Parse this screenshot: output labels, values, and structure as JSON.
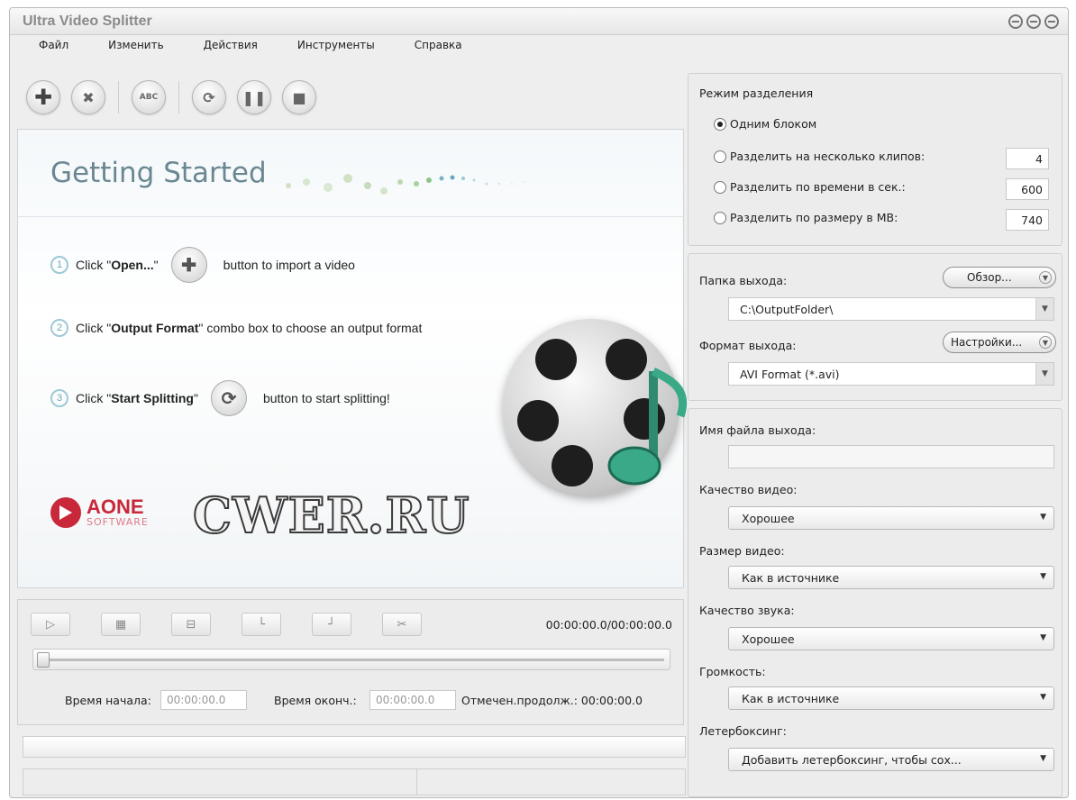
{
  "window": {
    "title": "Ultra Video Splitter"
  },
  "menu": [
    "Файл",
    "Изменить",
    "Действия",
    "Инструменты",
    "Справка"
  ],
  "toolbar": {
    "abc_label": "ABC"
  },
  "getting_started": {
    "title": "Getting Started",
    "steps": [
      {
        "num": "1",
        "prefix": "Click \"",
        "bold": "Open...",
        "suffix_q": "\"",
        "after": "button to import a video"
      },
      {
        "num": "2",
        "prefix": "Click \"",
        "bold": "Output Format",
        "suffix_q": "\"",
        "after": "combo box to choose an output format"
      },
      {
        "num": "3",
        "prefix": "Click \"",
        "bold": "Start Splitting",
        "suffix_q": "\"",
        "after": "button to start splitting!"
      }
    ]
  },
  "logos": {
    "aone_name": "AONE",
    "aone_sub": "SOFTWARE",
    "watermark": "CWER.RU"
  },
  "player": {
    "time_display": "00:00:00.0/00:00:00.0",
    "position": 0,
    "start_label": "Время начала:",
    "start_value": "00:00:00.0",
    "end_label": "Время оконч.:",
    "end_value": "00:00:00.0",
    "duration_label": "Отмечен.продолж.: 00:00:00.0"
  },
  "split_mode": {
    "title": "Режим разделения",
    "options": [
      {
        "label": "Одним блоком",
        "selected": true,
        "value": ""
      },
      {
        "label": "Разделить на несколько клипов:",
        "selected": false,
        "value": "4"
      },
      {
        "label": "Разделить по времени в сек.:",
        "selected": false,
        "value": "600"
      },
      {
        "label": "Разделить по размеру в МВ:",
        "selected": false,
        "value": "740"
      }
    ]
  },
  "output": {
    "folder_label": "Папка выхода:",
    "browse_label": "Обзор...",
    "folder_value": "C:\\OutputFolder\\",
    "format_label": "Формат выхода:",
    "settings_label": "Настройки...",
    "format_value": "AVI Format (*.avi)"
  },
  "options": {
    "filename_label": "Имя файла выхода:",
    "filename_value": "",
    "video_quality_label": "Качество видео:",
    "video_quality_value": "Хорошее",
    "video_size_label": "Размер видео:",
    "video_size_value": "Как в источнике",
    "audio_quality_label": "Качество звука:",
    "audio_quality_value": "Хорошее",
    "volume_label": "Громкость:",
    "volume_value": "Как в источнике",
    "letterbox_label": "Летербоксинг:",
    "letterbox_value": "Добавить летербоксинг, чтобы сох..."
  },
  "colors": {
    "accent_title": "#6b8791",
    "aone_red": "#c8283a"
  }
}
